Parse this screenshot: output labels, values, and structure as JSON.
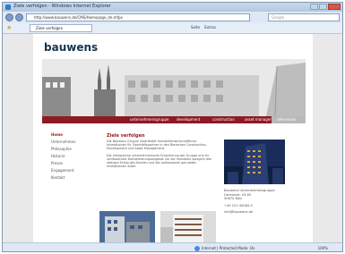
{
  "window": {
    "title": "Ziele verfolgen - Windows Internet Explorer"
  },
  "address_bar": {
    "url": "http://www.bauwens.de/CMS/Homepage_de.mfpx"
  },
  "search": {
    "placeholder": "Google"
  },
  "tab": {
    "label": "Ziele verfolgen"
  },
  "toolbar": {
    "page_label": "Seite",
    "tools_label": "Extras"
  },
  "site": {
    "logo": "bauwens",
    "nav": [
      "unternehmensgruppe",
      "development",
      "construction",
      "asset management",
      "referenzen"
    ],
    "side_menu": [
      {
        "label": "Home",
        "active": true
      },
      {
        "label": "Unternehmen",
        "active": false
      },
      {
        "label": "Philosophie",
        "active": false
      },
      {
        "label": "Historie",
        "active": false
      },
      {
        "label": "Presse",
        "active": false
      },
      {
        "label": "Engagement",
        "active": false
      },
      {
        "label": "Kontakt",
        "active": false
      }
    ],
    "heading": "Ziele verfolgen",
    "paragraph1": "Die Bauwens Gruppe verarbeitet immobilienwirtschaftliche Investitionen für Geschäftspartner in den Bereichen Construction, Development und Asset Management.",
    "paragraph2": "Die erfolgreiche unternehmerische Entwicklung der Gruppe und ihr umfassendes Dienstleistungsangebot um die Immobilie spiegeln den stetigen Erfolg des Kunden und die professionell genutzten Investitionen wider.",
    "address": {
      "company": "Bauwens Unternehmensgruppe",
      "street": "Gereonstr. 43-65",
      "city": "50670 Köln",
      "phone": "+49 221 40084-0",
      "email": "info@bauwens.de"
    }
  },
  "status": {
    "zone": "Internet | Protected Mode: On",
    "zoom": "100%"
  },
  "colors": {
    "brand_red": "#8d1a24",
    "logo_blue": "#15344f"
  }
}
